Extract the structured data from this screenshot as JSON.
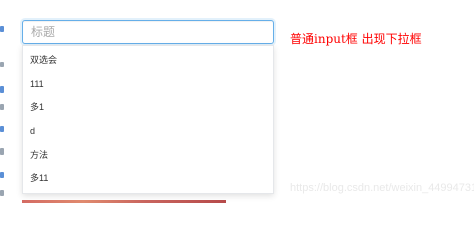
{
  "search": {
    "placeholder": "标题",
    "value": ""
  },
  "dropdown": {
    "options": [
      {
        "label": "双选会"
      },
      {
        "label": "111"
      },
      {
        "label": "多1"
      },
      {
        "label": "d"
      },
      {
        "label": "方法"
      },
      {
        "label": "多11"
      }
    ]
  },
  "annotation": {
    "text": "普通input框 出现下拉框"
  },
  "watermark": {
    "text": "https://blog.csdn.net/weixin_44994731"
  },
  "colors": {
    "focus_border": "#66afe9",
    "annotation_text": "#ff0000",
    "edge_marks": [
      "#5b8fd6",
      "#9aa5b1",
      "#5b8fd6",
      "#9aa5b1",
      "#5b8fd6",
      "#9aa5b1",
      "#5b8fd6",
      "#9aa5b1"
    ]
  }
}
